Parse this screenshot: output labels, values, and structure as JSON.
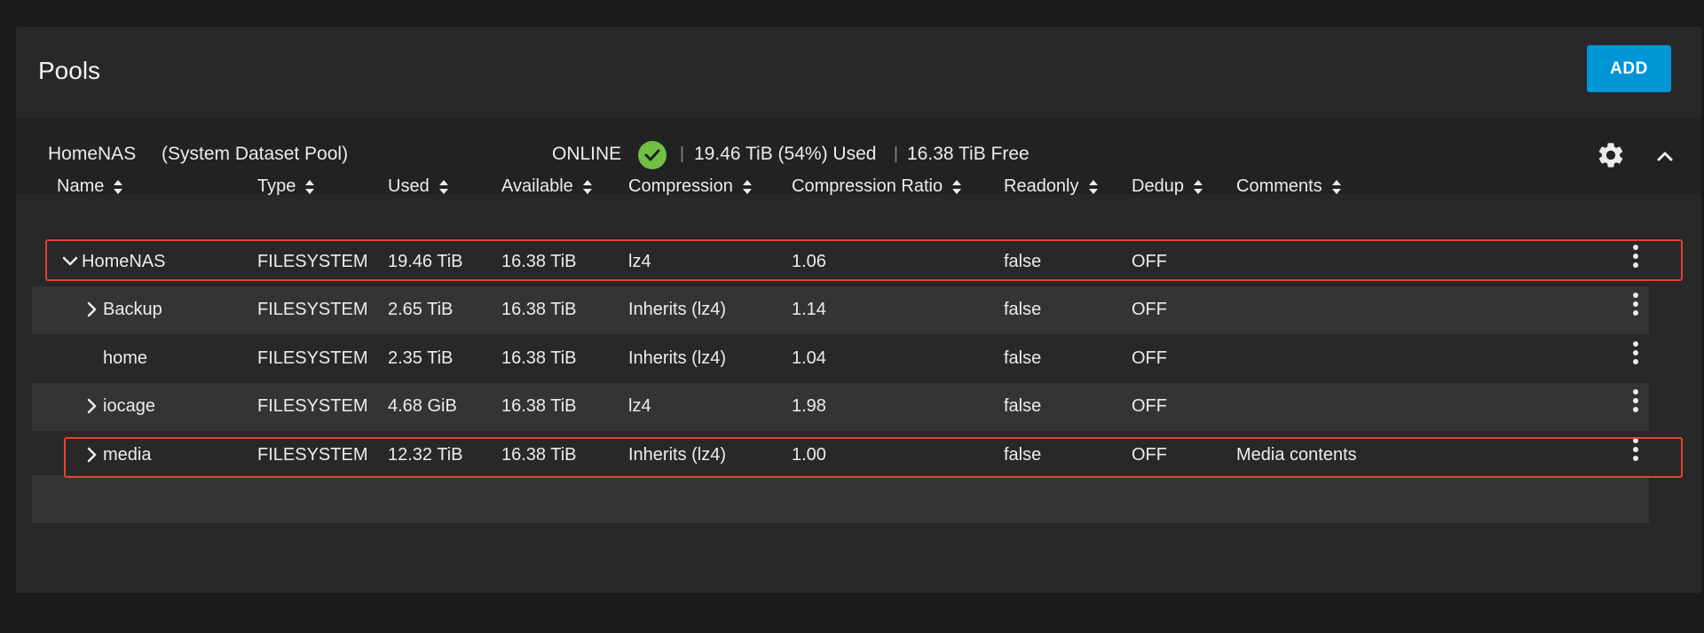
{
  "card": {
    "title": "Pools",
    "add_label": "ADD"
  },
  "pool": {
    "name": "HomeNAS",
    "subtitle": "(System Dataset Pool)",
    "status": "ONLINE",
    "status_icon": "check-circle-icon",
    "status_color": "#71bf44",
    "separator": "|",
    "used": "19.46 TiB (54%) Used",
    "free": "16.38 TiB Free"
  },
  "table": {
    "columns": [
      "Name",
      "Type",
      "Used",
      "Available",
      "Compression",
      "Compression Ratio",
      "Readonly",
      "Dedup",
      "Comments"
    ],
    "rows": [
      {
        "name": "HomeNAS",
        "type": "FILESYSTEM",
        "used": "19.46 TiB",
        "available": "16.38 TiB",
        "compression": "lz4",
        "ratio": "1.06",
        "readonly": "false",
        "dedup": "OFF",
        "comments": ""
      },
      {
        "name": "Backup",
        "type": "FILESYSTEM",
        "used": "2.65 TiB",
        "available": "16.38 TiB",
        "compression": "Inherits (lz4)",
        "ratio": "1.14",
        "readonly": "false",
        "dedup": "OFF",
        "comments": ""
      },
      {
        "name": "home",
        "type": "FILESYSTEM",
        "used": "2.35 TiB",
        "available": "16.38 TiB",
        "compression": "Inherits (lz4)",
        "ratio": "1.04",
        "readonly": "false",
        "dedup": "OFF",
        "comments": ""
      },
      {
        "name": "iocage",
        "type": "FILESYSTEM",
        "used": "4.68 GiB",
        "available": "16.38 TiB",
        "compression": "lz4",
        "ratio": "1.98",
        "readonly": "false",
        "dedup": "OFF",
        "comments": ""
      },
      {
        "name": "media",
        "type": "FILESYSTEM",
        "used": "12.32 TiB",
        "available": "16.38 TiB",
        "compression": "Inherits (lz4)",
        "ratio": "1.00",
        "readonly": "false",
        "dedup": "OFF",
        "comments": "Media contents"
      }
    ]
  },
  "colors": {
    "accent": "#0095d5",
    "highlight": "#e2432e",
    "background": "#1b1b1d",
    "card": "#282828"
  }
}
